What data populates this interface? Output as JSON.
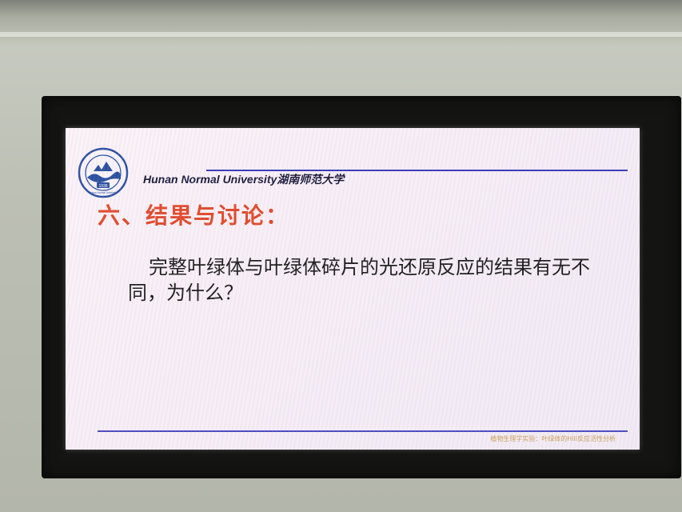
{
  "slide": {
    "header_institution": "Hunan Normal University湖南师范大学",
    "logo_year": "1938",
    "logo_caption": "Hunan Normal University",
    "title": "六、结果与讨论：",
    "body": "完整叶绿体与叶绿体碎片的光还原反应的结果有无不同，为什么？",
    "footer": "植物生理学实验：叶绿体的Hill反应活性分析"
  },
  "colors": {
    "title": "#e04a2a",
    "rule": "#3a3ab8",
    "logo": "#2b4fa0"
  }
}
